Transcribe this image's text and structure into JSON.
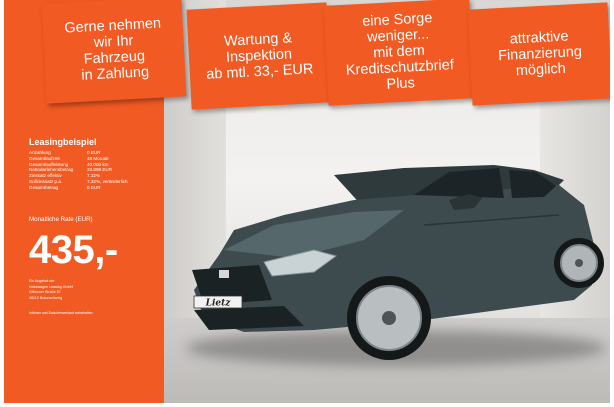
{
  "banners": [
    {
      "text": "Gerne nehmen\nwir Ihr\nFahrzeug\nin Zahlung"
    },
    {
      "text": "Wartung &\nInspektion\nab mtl. 33,- EUR"
    },
    {
      "text": "eine Sorge weniger...\nmit dem\nKreditschutzbrief\nPlus"
    },
    {
      "text": "attraktive\nFinanzierung\nmöglich"
    }
  ],
  "leasing": {
    "title": "Leasingbeispiel",
    "rows": [
      {
        "label": "Anzahlung",
        "value": "0 EUR"
      },
      {
        "label": "Gesamtlaufzeit",
        "value": "48 Monate"
      },
      {
        "label": "Gesamtlaufleistung",
        "value": "40.000 km"
      },
      {
        "label": "Nettodarlehensbetrag",
        "value": "33.898 EUR"
      },
      {
        "label": "Zinssatz effektiv",
        "value": "7,32%"
      },
      {
        "label": "Sollzinssatz p.a.",
        "value": "7,32%, veränderlich"
      },
      {
        "label": "Gesamtbetrag",
        "value": "0 EUR"
      }
    ],
    "rate_label": "Monatliche Rate (EUR)",
    "price": "435,-",
    "provider": [
      "Ein Angebot der",
      "Volkswagen Leasing GmbH",
      "Gifhorner Straße 57",
      "38112 Braunschweig"
    ],
    "footnote": "Irrtümer und Zwischenverkauf vorbehalten"
  },
  "plate": {
    "text": "Lietz"
  },
  "colors": {
    "brand_orange": "#f15a22",
    "car_body": "#3d4a4e"
  }
}
